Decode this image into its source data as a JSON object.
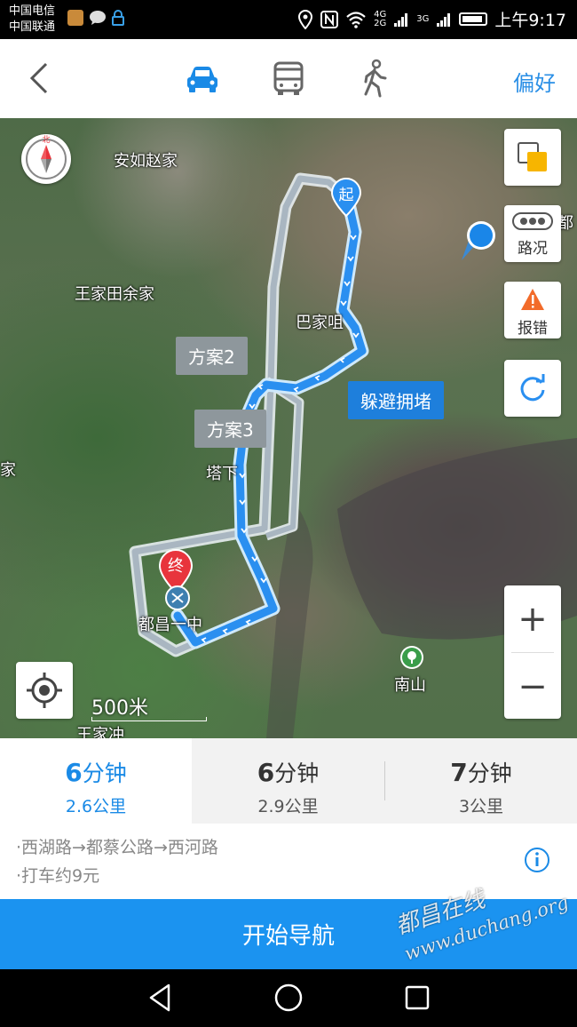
{
  "status_bar": {
    "carrier_1": "中国电信",
    "carrier_2": "中国联通",
    "signal_1_top": "4G",
    "signal_1_bottom": "2G",
    "signal_2": "3G",
    "time": "上午9:17"
  },
  "top_nav": {
    "modes": [
      "drive",
      "bus",
      "walk"
    ],
    "selected_mode": "drive",
    "prefs_label": "偏好",
    "accent_color": "#2a8fe6"
  },
  "map": {
    "place_labels": {
      "anru": "安如赵家",
      "wangjia_tian": "王家田余家",
      "bajia": "巴家咀",
      "taxia": "塔下",
      "jia": "家",
      "school": "都昌一中",
      "nanshan": "南山",
      "wangjiachong": "王家冲",
      "duchang_edge": "都"
    },
    "callouts": {
      "plan2": "方案2",
      "plan3": "方案3",
      "avoid": "躲避拥堵"
    },
    "markers": {
      "start": "起",
      "end": "终"
    },
    "buttons": {
      "traffic": "路况",
      "report": "报错"
    },
    "compass_label": "北",
    "scale": "500米",
    "zoom_in": "+",
    "zoom_out": "−"
  },
  "routes": [
    {
      "time_num": "6",
      "time_unit": "分钟",
      "distance": "2.6公里",
      "selected": true
    },
    {
      "time_num": "6",
      "time_unit": "分钟",
      "distance": "2.9公里",
      "selected": false
    },
    {
      "time_num": "7",
      "time_unit": "分钟",
      "distance": "3公里",
      "selected": false
    }
  ],
  "details": {
    "path": "·西湖路→都蔡公路→西河路",
    "taxi": "·打车约9元"
  },
  "start_nav_label": "开始导航",
  "watermark": {
    "cn": "都昌在线",
    "url": "www.duchang.org"
  }
}
